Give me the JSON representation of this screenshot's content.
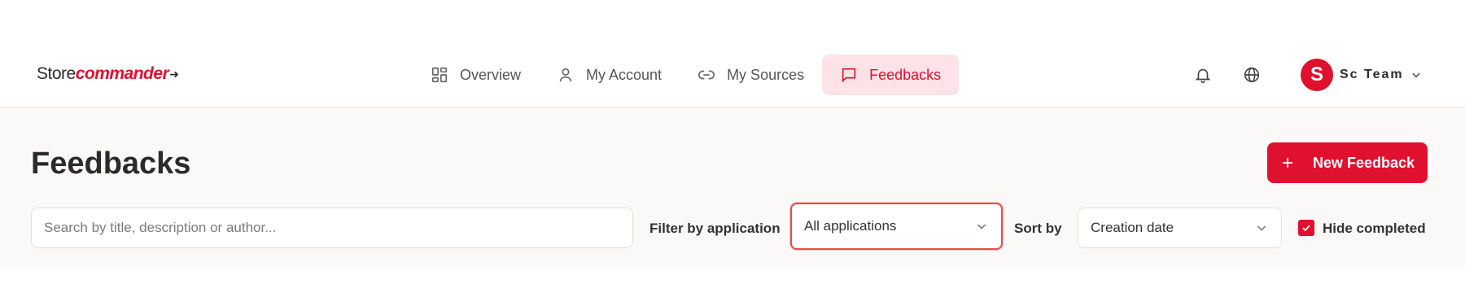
{
  "header": {
    "logo": {
      "store": "Store",
      "commander": "commander"
    },
    "nav": [
      {
        "label": "Overview",
        "icon": "grid-icon",
        "active": false
      },
      {
        "label": "My Account",
        "icon": "user-icon",
        "active": false
      },
      {
        "label": "My Sources",
        "icon": "link-icon",
        "active": false
      },
      {
        "label": "Feedbacks",
        "icon": "message-square-icon",
        "active": true
      }
    ],
    "tools": {
      "notifications_icon": "bell-icon",
      "language_icon": "globe-icon"
    },
    "user": {
      "initial": "S",
      "name": "Sc Team"
    }
  },
  "page": {
    "title": "Feedbacks",
    "new_button_label": "New Feedback"
  },
  "filters": {
    "search_placeholder": "Search by title, description or author...",
    "search_value": "",
    "filter_label": "Filter by application",
    "application_value": "All applications",
    "sort_label": "Sort by",
    "sort_value": "Creation date",
    "hide_completed_label": "Hide completed",
    "hide_completed_checked": true
  },
  "colors": {
    "brand": "#e0102f",
    "active_nav_bg": "#fde3e7",
    "content_bg": "#fbf9f7"
  }
}
